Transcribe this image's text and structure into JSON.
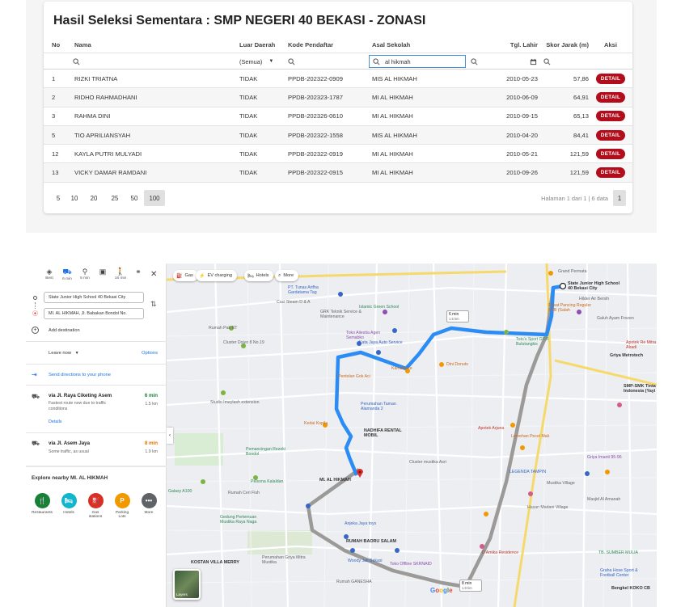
{
  "selection": {
    "title": "Hasil Seleksi Sementara : SMP NEGERI 40 BEKASI - ZONASI",
    "columns": [
      "No",
      "Nama",
      "Luar Daerah",
      "Kode Pendaftar",
      "Asal Sekolah",
      "Tgl. Lahir",
      "Skor Jarak (m)",
      "Aksi"
    ],
    "filters": {
      "luar_daerah": "(Semua)",
      "asal_sekolah": "al hikmah"
    },
    "rows": [
      {
        "no": "1",
        "nama": "RIZKI TRIATNA",
        "luar": "TIDAK",
        "kode": "PPDB-202322-0909",
        "asal": "MIS AL HIKMAH",
        "tgl": "2010-05-23",
        "skor": "57,86",
        "aksi": "DETAIL"
      },
      {
        "no": "2",
        "nama": "RIDHO RAHMADHANI",
        "luar": "TIDAK",
        "kode": "PPDB-202323-1787",
        "asal": "MI AL HIKMAH",
        "tgl": "2010-06-09",
        "skor": "64,91",
        "aksi": "DETAIL"
      },
      {
        "no": "3",
        "nama": "RAHMA DINI",
        "luar": "TIDAK",
        "kode": "PPDB-202326-0610",
        "asal": "MI AL HIKMAH",
        "tgl": "2010-09-15",
        "skor": "65,13",
        "aksi": "DETAIL"
      },
      {
        "no": "5",
        "nama": "TIO APRILIANSYAH",
        "luar": "TIDAK",
        "kode": "PPDB-202322-1558",
        "asal": "MIS AL HIKMAH",
        "tgl": "2010-04-20",
        "skor": "84,41",
        "aksi": "DETAIL"
      },
      {
        "no": "12",
        "nama": "KAYLA PUTRI MULYADI",
        "luar": "TIDAK",
        "kode": "PPDB-202322-0919",
        "asal": "MI AL HIKMAH",
        "tgl": "2010-05-21",
        "skor": "121,59",
        "aksi": "DETAIL"
      },
      {
        "no": "13",
        "nama": "VICKY DAMAR RAMDANI",
        "luar": "TIDAK",
        "kode": "PPDB-202322-0915",
        "asal": "MI AL HIKMAH",
        "tgl": "2010-09-26",
        "skor": "121,59",
        "aksi": "DETAIL"
      }
    ],
    "page_sizes": [
      "5",
      "10",
      "20",
      "25",
      "50",
      "100"
    ],
    "page_size_selected": "100",
    "page_info": "Halaman 1 dari 1 | 6 data",
    "current_page": "1"
  },
  "directions": {
    "modes": [
      {
        "label": "Best",
        "icon": "diamond-route-icon"
      },
      {
        "label": "6 min",
        "icon": "car-icon"
      },
      {
        "label": "5 min",
        "icon": "motorcycle-icon"
      },
      {
        "label": "",
        "icon": "transit-icon"
      },
      {
        "label": "16 min",
        "icon": "walk-icon"
      },
      {
        "label": "",
        "icon": "bicycle-icon"
      }
    ],
    "origin": "State Junior High School 40 Bekasi City",
    "destination": "MI. AL HIKMAH, Jl. Babakan Bondol No.",
    "add_destination": "Add destination",
    "leave_now": "Leave now",
    "options": "Options",
    "send_to_phone": "Send directions to your phone",
    "routes": [
      {
        "via": "via Jl. Raya Ciketing Asem",
        "time": "6 min",
        "distance": "1.5 km",
        "note1": "Fastest route now due to traffic",
        "note2": "conditions",
        "details": "Details"
      },
      {
        "via": "via Jl. Asem Jaya",
        "time": "8 min",
        "distance": "1.9 km",
        "note1": "Some traffic, as usual",
        "note2": "",
        "details": ""
      }
    ],
    "explore_title": "Explore nearby MI. AL HIKMAH",
    "explore": [
      "Restaurants",
      "Hotels",
      "Gas stations",
      "Parking Lots",
      "More"
    ]
  },
  "map": {
    "chips": [
      "Gas",
      "EV charging",
      "Hotels",
      "More"
    ],
    "dest_label": "State Junior High School 40 Bekasi City",
    "origin_label": "MI. AL HIKMAH",
    "route_box_1": {
      "time": "6 min",
      "dist": "1.5 km"
    },
    "route_box_2": {
      "time": "8 min",
      "dist": "1.9 km"
    },
    "labels": [
      "PT. Tunas Arifha Gardatama Tag",
      "Cuci Steam D & A",
      "GRK Teknik Service & Maintenance",
      "Islamic Green School",
      "Toko Aiiestia Agen Semabko",
      "Kata Jaya Auto Service",
      "Rumah Pak RT",
      "Cluster Dojyo 8 No.19",
      "Kamakioce",
      "Toto's Sport GOR Bulutangkis",
      "Dini Donuts",
      "Pentolan Gok Aci",
      "Grand Permata",
      "Pusat Pancing Reguler SKB (Salah",
      "Hilder Air Bersih",
      "Galuh Ayam Frozen",
      "Apotek Re Mitra Abadi",
      "Griya Metrotech",
      "SMP-SMK Tinta Indonesia (Yayi",
      "Kedai Kopila",
      "NADHIFA RENTAL MOBIL",
      "Perumahan Taman Alamanda 2",
      "Apotek Arjuna",
      "Lemehan Pecel Mak",
      "Studio Imeylash extension",
      "Pemancingan Rezeki Bondol",
      "Pelsona Kalaldan",
      "Cluster mustika Asri",
      "LEGENDA TAMPIN",
      "Griya Imanti 95-96",
      "Mustika Village",
      "Masjid Al Amanah",
      "Hasan Madani Village",
      "Anjeka Jaya toys",
      "RUMAH BAORU SALAM",
      "D'Amika Residence",
      "Gedung Pertemuan Mustika Raya Naga",
      "Woody Jati Bekasi",
      "Toko Offline SKRNAID",
      "Rumah GANESHA",
      "Perumahan Griya Mitra Mustika",
      "KOSTAN VILLA MERRY",
      "Graha Hose Sport & Football Center",
      "TB. SUMBER MULIA",
      "Bengkel KOKO CB",
      "Galaxy A100",
      "Rumah Ceri Fish"
    ],
    "layers_label": "Layers",
    "google": "Google",
    "colors": {
      "route_primary": "#2b8cf5",
      "route_alt": "#9c9a98",
      "pin": "#d93025"
    }
  }
}
